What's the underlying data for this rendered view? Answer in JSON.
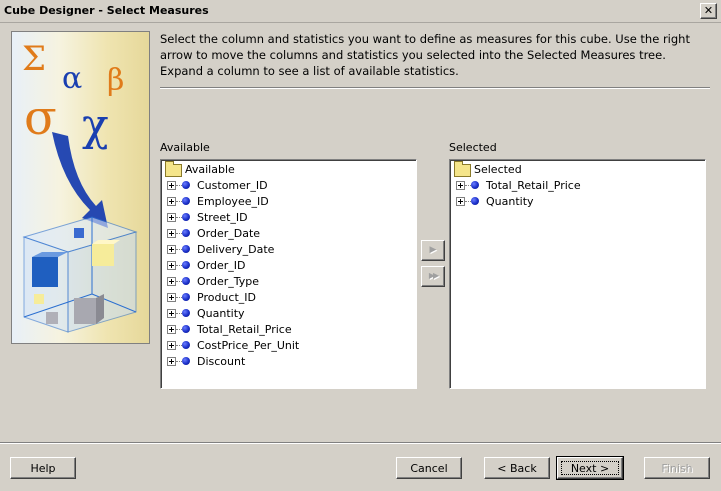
{
  "window": {
    "title": "Cube Designer - Select Measures",
    "close_glyph": "✕"
  },
  "instructions": "Select the column and statistics you want to define as measures for this cube.  Use the right arrow to move the columns and statistics you selected into the Selected Measures tree.  Expand a column to see a list of available statistics.",
  "available": {
    "label": "Available",
    "root_label": "Available",
    "items": [
      "Customer_ID",
      "Employee_ID",
      "Street_ID",
      "Order_Date",
      "Delivery_Date",
      "Order_ID",
      "Order_Type",
      "Product_ID",
      "Quantity",
      "Total_Retail_Price",
      "CostPrice_Per_Unit",
      "Discount"
    ]
  },
  "selected": {
    "label": "Selected",
    "root_label": "Selected",
    "items": [
      "Total_Retail_Price",
      "Quantity"
    ]
  },
  "move_buttons": {
    "move_one": "▶",
    "move_all": "▶▶"
  },
  "buttons": {
    "help": "Help",
    "cancel": "Cancel",
    "back": "< Back",
    "next": "Next >",
    "finish": "Finish"
  },
  "graphic": {
    "symbols": [
      "Σ",
      "α",
      "β",
      "σ",
      "χ"
    ]
  }
}
